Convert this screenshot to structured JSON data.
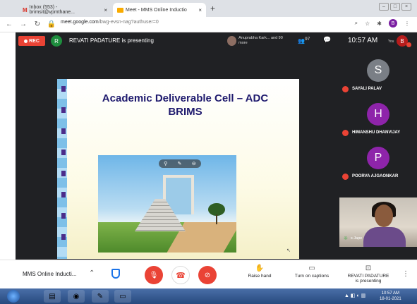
{
  "browser": {
    "tabs": [
      {
        "label": "Inbox (553) - brimsit@vpmthane...",
        "icon": "gmail-icon"
      },
      {
        "label": "Meet - MMS Online Inductio",
        "icon": "meet-icon"
      }
    ],
    "new_tab": "+",
    "url_host": "meet.google.com",
    "url_path": "/bwg-evsn-nag?authuser=0"
  },
  "meet": {
    "rec_label": "REC",
    "presenter_initial": "R",
    "presenting_text": "REVATI PADATURE is presenting",
    "participants_preview": "Anuprabha Kark... and 90 more",
    "people_count": "97",
    "time": "10:57 AM",
    "you_label": "You",
    "you_initial": "B"
  },
  "slide": {
    "title_line1": "Academic Deliverable Cell – ADC",
    "title_line2": "BRIMS"
  },
  "tiles": [
    {
      "initial": "S",
      "name": "SAYALI PALAV",
      "color": "#7a7f86"
    },
    {
      "initial": "H",
      "name": "HIMANSHU DHANVIJAY",
      "color": "#8e24aa"
    },
    {
      "initial": "P",
      "name": "POORVA AJGAONKAR",
      "color": "#8e24aa"
    }
  ],
  "camera_tile": {
    "name": "s Jape"
  },
  "bottom": {
    "meeting_name": "MMS Online Inducti...",
    "raise_hand": "Raise hand",
    "captions": "Turn on captions",
    "presenter_line1": "REVATI PADATURE",
    "presenter_line2": "is presenting"
  },
  "taskbar": {
    "time": "10:57 AM",
    "date": "18-01-2021"
  }
}
